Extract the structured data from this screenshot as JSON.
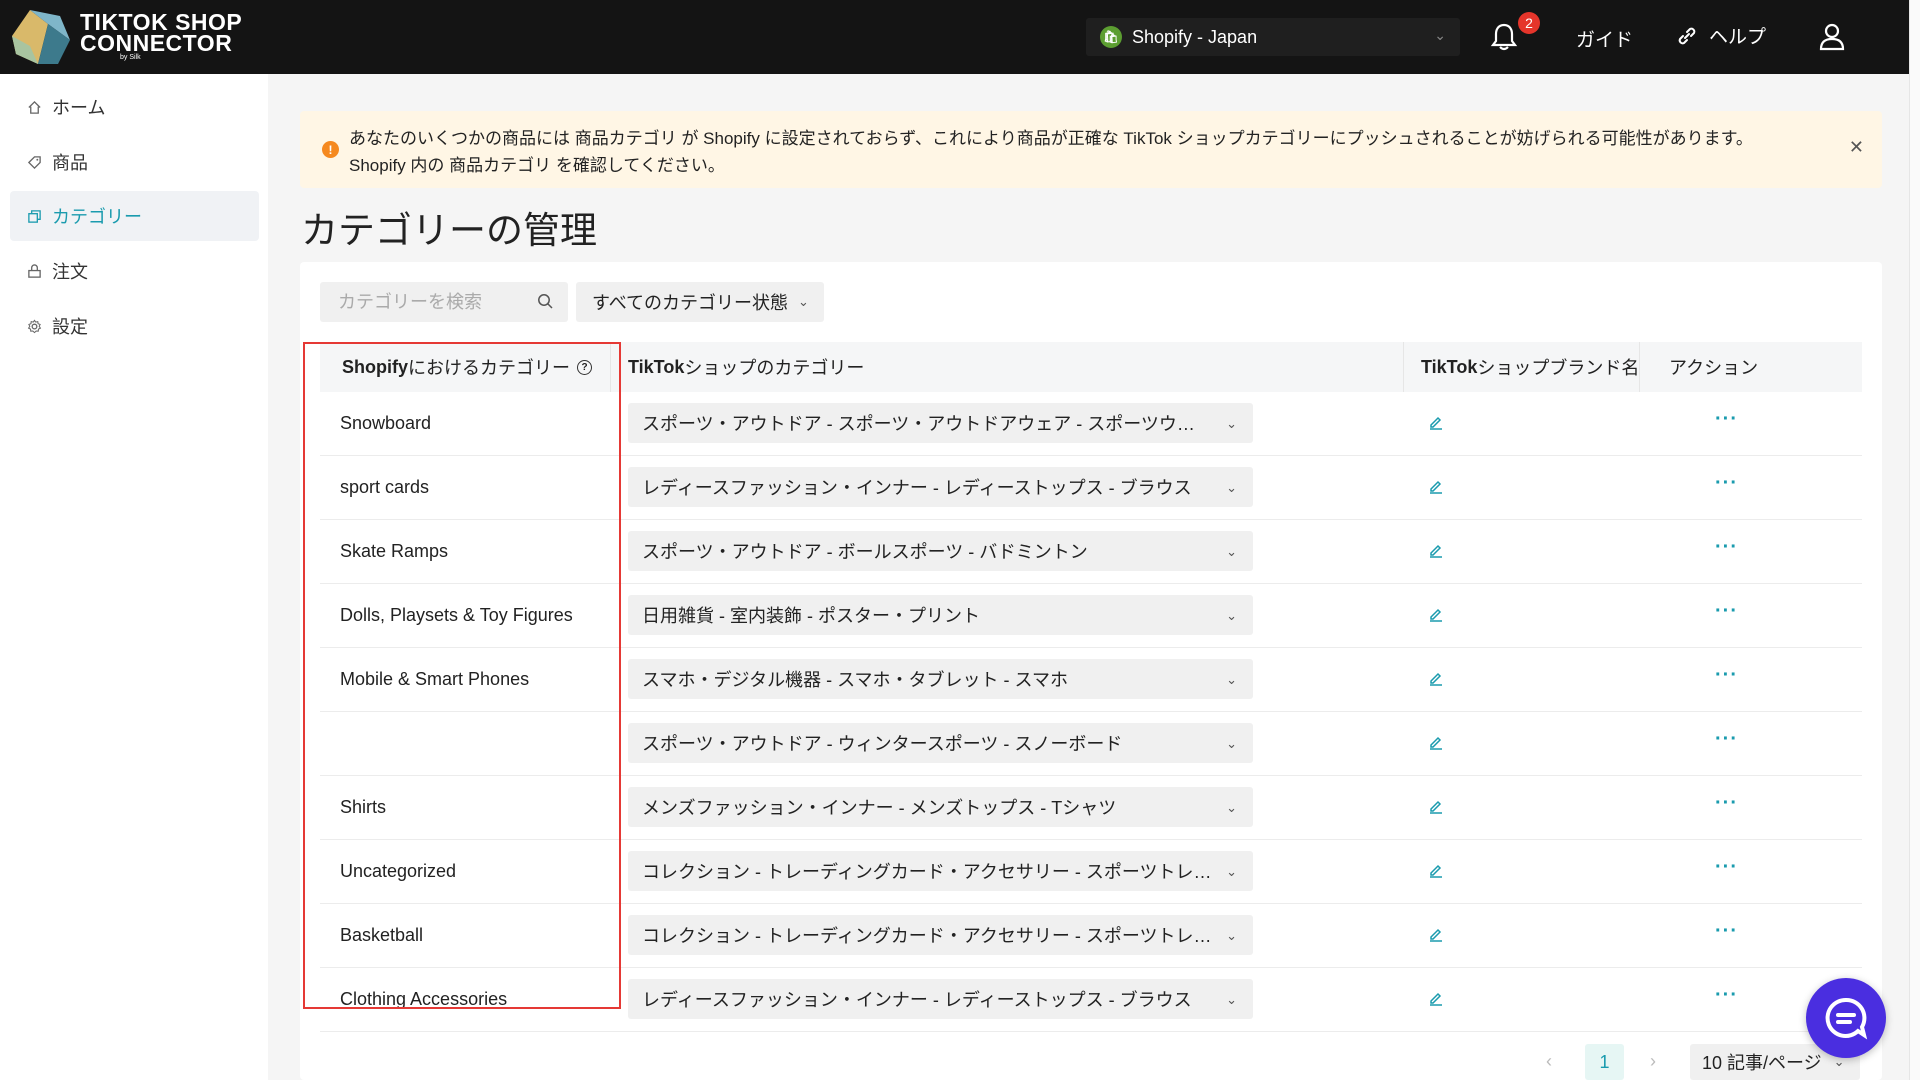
{
  "app": {
    "logo_line1": "TIKTOK SHOP",
    "logo_line2": "CONNECTOR",
    "logo_sub": "by Silk"
  },
  "header": {
    "store_name": "Shopify - Japan",
    "notification_count": "2",
    "guide_label": "ガイド",
    "help_label": "ヘルプ"
  },
  "sidebar": {
    "items": [
      {
        "label": "ホーム",
        "icon": "home-icon"
      },
      {
        "label": "商品",
        "icon": "tag-icon"
      },
      {
        "label": "カテゴリー",
        "icon": "category-icon",
        "active": true
      },
      {
        "label": "注文",
        "icon": "lock-icon"
      },
      {
        "label": "設定",
        "icon": "gear-icon"
      }
    ]
  },
  "alert": {
    "line1": "あなたのいくつかの商品には 商品カテゴリ が Shopify に設定されておらず、これにより商品が正確な TikTok ショップカテゴリーにプッシュされることが妨げられる可能性があります。",
    "line2": "Shopify 内の 商品カテゴリ を確認してください。"
  },
  "page": {
    "title": "カテゴリーの管理"
  },
  "filters": {
    "search_placeholder": "カテゴリーを検索",
    "status_label": "すべてのカテゴリー状態"
  },
  "table": {
    "headers": {
      "shopify_bold": "Shopify",
      "shopify_rest": " におけるカテゴリー",
      "tiktok_bold": "TikTok",
      "tiktok_rest": " ショップのカテゴリー",
      "brand_bold": "TikTok",
      "brand_rest": " ショップブランド名",
      "action": "アクション"
    },
    "rows": [
      {
        "shopify": "Snowboard",
        "tiktok": "スポーツ・アウトドア - スポーツ・アウトドアウェア - スポーツウェア..."
      },
      {
        "shopify": "sport cards",
        "tiktok": "レディースファッション・インナー - レディーストップス - ブラウス"
      },
      {
        "shopify": "Skate Ramps",
        "tiktok": "スポーツ・アウトドア - ボールスポーツ - バドミントン"
      },
      {
        "shopify": "Dolls, Playsets & Toy Figures",
        "tiktok": "日用雑貨 - 室内装飾 - ポスター・プリント"
      },
      {
        "shopify": "Mobile & Smart Phones",
        "tiktok": "スマホ・デジタル機器 - スマホ・タブレット - スマホ"
      },
      {
        "shopify": "",
        "tiktok": "スポーツ・アウトドア - ウィンタースポーツ - スノーボード"
      },
      {
        "shopify": "Shirts",
        "tiktok": "メンズファッション・インナー - メンズトップス - Tシャツ"
      },
      {
        "shopify": "Uncategorized",
        "tiktok": "コレクション - トレーディングカード・アクセサリー - スポーツトレー..."
      },
      {
        "shopify": "Basketball",
        "tiktok": "コレクション - トレーディングカード・アクセサリー - スポーツトレー..."
      },
      {
        "shopify": "Clothing Accessories",
        "tiktok": "レディースファッション・インナー - レディーストップス - ブラウス"
      }
    ]
  },
  "pagination": {
    "current_page": "1",
    "page_size": "10 記事/ページ"
  },
  "colors": {
    "accent": "#1a9bae",
    "topbar": "#141414",
    "alert_bg": "#fff6e5",
    "highlight": "#e53935",
    "chat_fab": "#4a2ee0"
  }
}
